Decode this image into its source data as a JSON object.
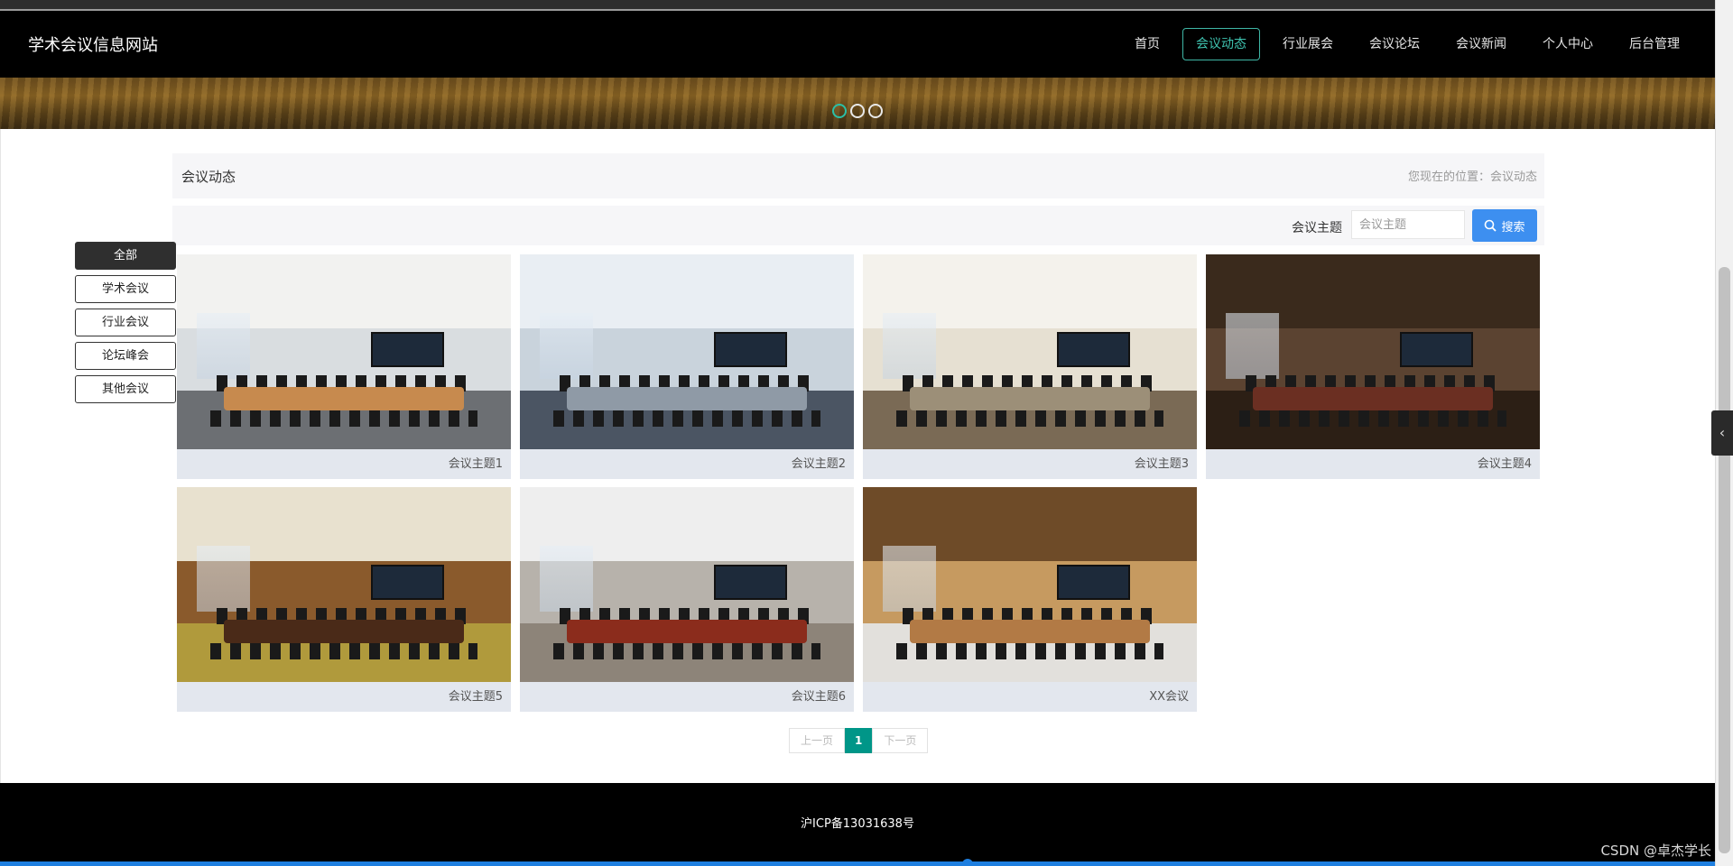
{
  "site": {
    "title": "学术会议信息网站"
  },
  "nav": [
    {
      "label": "首页",
      "active": false
    },
    {
      "label": "会议动态",
      "active": true
    },
    {
      "label": "行业展会",
      "active": false
    },
    {
      "label": "会议论坛",
      "active": false
    },
    {
      "label": "会议新闻",
      "active": false
    },
    {
      "label": "个人中心",
      "active": false
    },
    {
      "label": "后台管理",
      "active": false
    }
  ],
  "banner": {
    "slides": 3,
    "active_slide": 1
  },
  "page": {
    "title": "会议动态",
    "breadcrumb_prefix": "您现在的位置：",
    "breadcrumb_current": "会议动态"
  },
  "search": {
    "label": "会议主题",
    "placeholder": "会议主题",
    "button_label": "搜索"
  },
  "categories": [
    {
      "label": "全部",
      "active": true
    },
    {
      "label": "学术会议",
      "active": false
    },
    {
      "label": "行业会议",
      "active": false
    },
    {
      "label": "论坛峰会",
      "active": false
    },
    {
      "label": "其他会议",
      "active": false
    }
  ],
  "cards": [
    {
      "caption": "会议主题1",
      "palette": {
        "ceil": "#f2f2f0",
        "wall": "#d9dde0",
        "floor": "#6c6f73",
        "table": "#c78a4e"
      }
    },
    {
      "caption": "会议主题2",
      "palette": {
        "ceil": "#e9eef3",
        "wall": "#c9d3dc",
        "floor": "#4b5563",
        "table": "#8f9aa6"
      }
    },
    {
      "caption": "会议主题3",
      "palette": {
        "ceil": "#f4f2ec",
        "wall": "#e6e0d2",
        "floor": "#7a6a55",
        "table": "#9c8f78"
      }
    },
    {
      "caption": "会议主题4",
      "palette": {
        "ceil": "#3a2a1c",
        "wall": "#5b4331",
        "floor": "#2c1f15",
        "table": "#6b2f22"
      }
    },
    {
      "caption": "会议主题5",
      "palette": {
        "ceil": "#e8e1cf",
        "wall": "#8a5a2c",
        "floor": "#b09a3c",
        "table": "#4a2a18"
      }
    },
    {
      "caption": "会议主题6",
      "palette": {
        "ceil": "#eeeeee",
        "wall": "#b7b2ab",
        "floor": "#8d8479",
        "table": "#8b2c1c"
      }
    },
    {
      "caption": "XX会议",
      "palette": {
        "ceil": "#6e4b28",
        "wall": "#c69a60",
        "floor": "#e2e0dc",
        "table": "#b27a45"
      }
    }
  ],
  "pagination": {
    "prev": "上一页",
    "current": "1",
    "next": "下一页"
  },
  "footer": {
    "icp": "沪ICP备13031638号"
  },
  "watermark": "CSDN @卓杰学长"
}
